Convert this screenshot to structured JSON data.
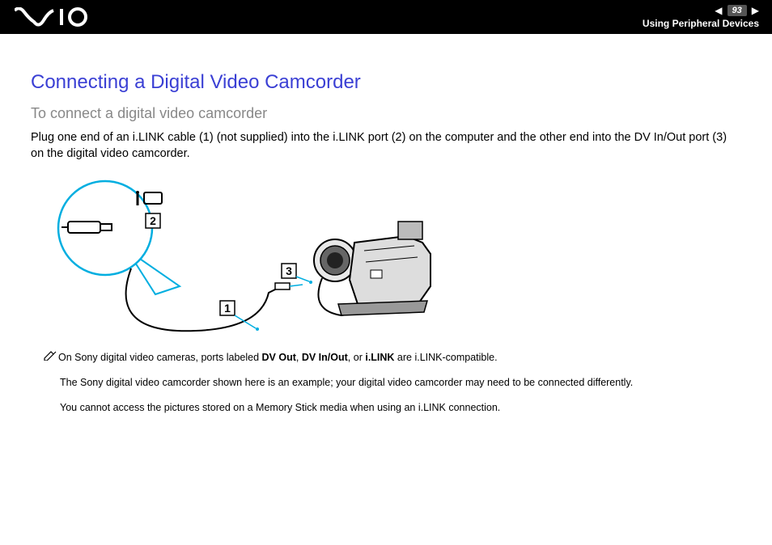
{
  "header": {
    "page_number": "93",
    "section": "Using Peripheral Devices"
  },
  "content": {
    "title_main": "Connecting a Digital Video Camcorder",
    "title_sub": "To connect a digital video camcorder",
    "body": "Plug one end of an i.LINK cable (1) (not supplied) into the i.LINK port (2) on the computer and the other end into the DV In/Out port (3) on the digital video camcorder.",
    "callouts": {
      "c1": "1",
      "c2": "2",
      "c3": "3"
    },
    "notes": {
      "n1_pre": "On Sony digital video cameras, ports labeled ",
      "n1_b1": "DV Out",
      "n1_s1": ", ",
      "n1_b2": "DV In/Out",
      "n1_s2": ", or ",
      "n1_b3": "i.LINK",
      "n1_post": " are i.LINK-compatible.",
      "n2": "The Sony digital video camcorder shown here is an example; your digital video camcorder may need to be connected differently.",
      "n3": "You cannot access the pictures stored on a Memory Stick media when using an i.LINK connection."
    }
  }
}
